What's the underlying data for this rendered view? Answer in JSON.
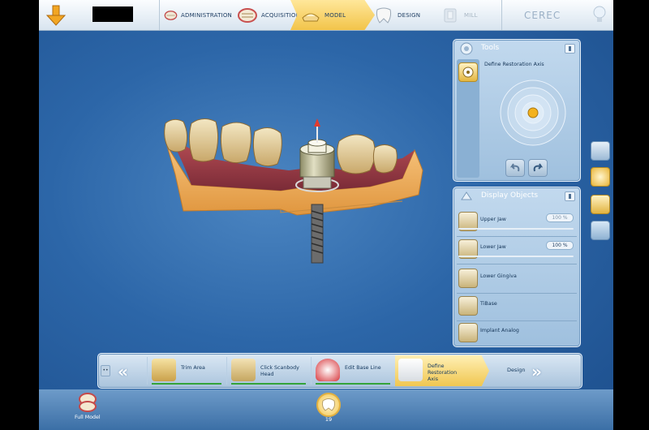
{
  "topbar": {
    "steps": [
      {
        "label": "ADMINISTRATION",
        "icon": "jaw-icon",
        "state": "done"
      },
      {
        "label": "ACQUISITION",
        "icon": "scan-jaw-icon",
        "state": "done"
      },
      {
        "label": "MODEL",
        "icon": "model-icon",
        "state": "active"
      },
      {
        "label": "DESIGN",
        "icon": "design-tooth-icon",
        "state": "normal"
      },
      {
        "label": "MILL",
        "icon": "mill-icon",
        "state": "disabled"
      }
    ],
    "brand": "CEREC"
  },
  "tools": {
    "title": "Tools",
    "tool_label": "Define Restoration Axis"
  },
  "display_objects": {
    "title": "Display Objects",
    "items": [
      {
        "name": "Upper Jaw",
        "percent": "100 %",
        "icon": "upper-jaw-icon",
        "slider": true,
        "enabled": false
      },
      {
        "name": "Lower Jaw",
        "percent": "100 %",
        "icon": "lower-jaw-icon",
        "slider": true,
        "enabled": true
      },
      {
        "name": "Lower Gingiva",
        "icon": "gingiva-icon"
      },
      {
        "name": "TiBase",
        "icon": "tibase-icon"
      },
      {
        "name": "Implant Analog",
        "icon": "implant-analog-icon"
      }
    ]
  },
  "right_rail": [
    "cube-view-icon",
    "axis-orient-icon",
    "implant-tool-icon",
    "screenshot-icon"
  ],
  "workflow": {
    "steps": [
      {
        "label": "Trim Area",
        "icon": "trim-area-icon",
        "done": true
      },
      {
        "label": "Click Scanbody Head",
        "icon": "scanbody-icon",
        "done": true
      },
      {
        "label": "Edit Base Line",
        "icon": "base-line-icon",
        "done": true
      },
      {
        "label": "Define Restoration Axis",
        "icon": "restoration-axis-icon",
        "active": true
      }
    ],
    "next_label": "Design"
  },
  "bottom": {
    "full_model_label": "Full Model",
    "tooth_number": "19"
  },
  "colors": {
    "accent": "#f2c44a",
    "done_bar": "#34a33a",
    "background": "#2c66a8"
  }
}
